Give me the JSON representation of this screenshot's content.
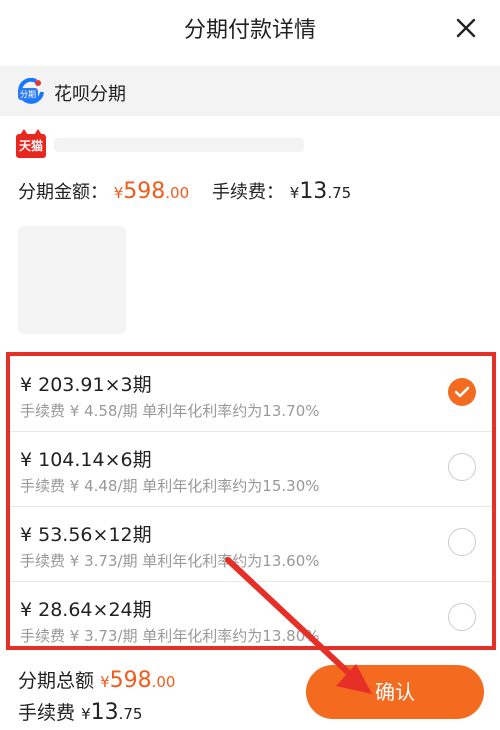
{
  "header": {
    "title": "分期付款详情",
    "close_icon": "close-icon"
  },
  "payment_method": {
    "label": "花呗分期",
    "logo_icon": "huabei-logo-icon",
    "logo_text": "分期"
  },
  "product": {
    "store_badge": "天猫",
    "installment_amount_label": "分期金额：",
    "installment_amount_currency": "¥",
    "installment_amount_int": "598",
    "installment_amount_dec": ".00",
    "fee_label": "手续费：",
    "fee_currency": "¥",
    "fee_int": "13",
    "fee_dec": ".75"
  },
  "plans": [
    {
      "main": "¥ 203.91×3期",
      "sub": "手续费 ¥ 4.58/期 单利年化利率约为13.70%",
      "selected": true
    },
    {
      "main": "¥ 104.14×6期",
      "sub": "手续费 ¥ 4.48/期 单利年化利率约为15.30%",
      "selected": false
    },
    {
      "main": "¥ 53.56×12期",
      "sub": "手续费 ¥ 3.73/期 单利年化利率约为13.60%",
      "selected": false
    },
    {
      "main": "¥ 28.64×24期",
      "sub": "手续费 ¥ 3.73/期 单利年化利率约为13.80%",
      "selected": false
    }
  ],
  "footer": {
    "total_label": "分期总额",
    "total_currency": "¥",
    "total_int": "598",
    "total_dec": ".00",
    "fee_label": "手续费",
    "fee_currency": "¥",
    "fee_int": "13",
    "fee_dec": ".75"
  },
  "confirm_button": {
    "label": "确认"
  },
  "colors": {
    "accent": "#f25b1c",
    "highlight_border": "#e62f27",
    "button": "#f46a1f"
  }
}
